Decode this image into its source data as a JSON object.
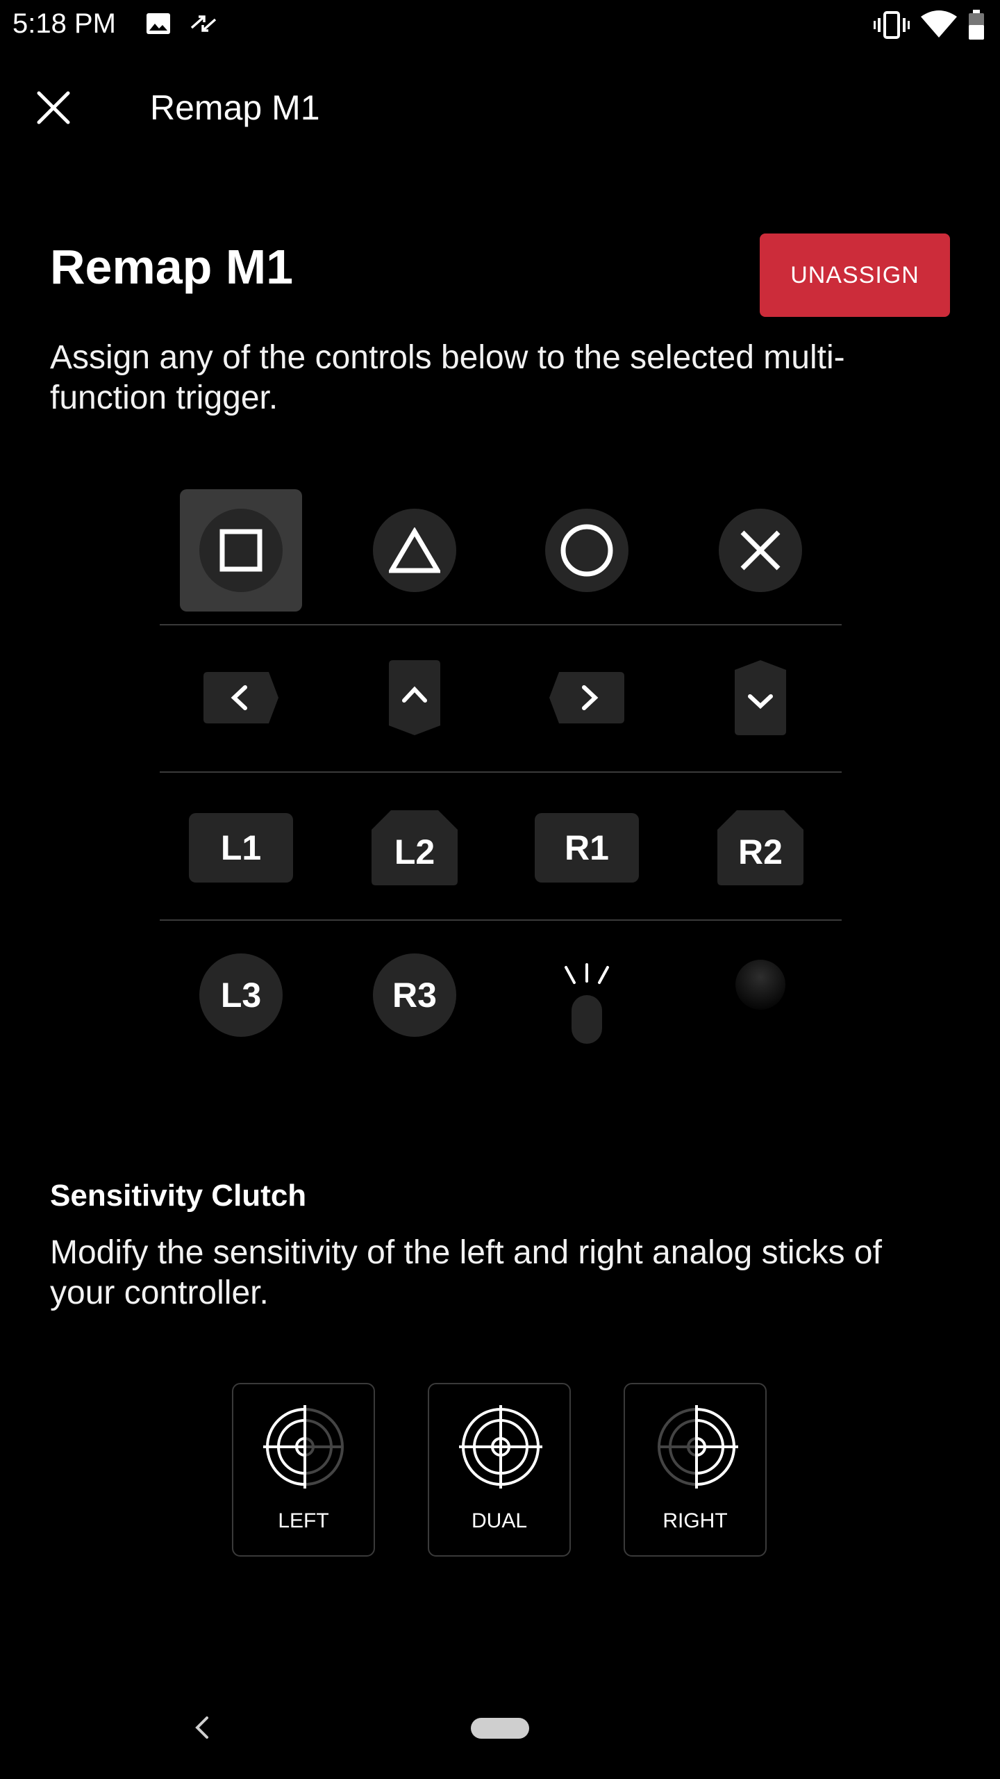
{
  "status_bar": {
    "time": "5:18 PM",
    "left_icons": [
      "image-icon",
      "sync-arrows-icon"
    ],
    "right_icons": [
      "vibrate-icon",
      "wifi-icon",
      "battery-icon"
    ]
  },
  "app_bar": {
    "title": "Remap M1"
  },
  "header": {
    "title": "Remap M1",
    "unassign_label": "UNASSIGN",
    "description": "Assign any of the controls below to the selected multi-function trigger."
  },
  "controls": {
    "face_buttons": [
      "square",
      "triangle",
      "circle",
      "cross"
    ],
    "selected": "square",
    "dpad": [
      "left",
      "up",
      "right",
      "down"
    ],
    "shoulders": [
      "L1",
      "L2",
      "R1",
      "R2"
    ],
    "sticks_row": [
      "L3",
      "R3",
      "touchpad-icon",
      "ball-icon"
    ]
  },
  "sensitivity": {
    "title": "Sensitivity Clutch",
    "description": "Modify the sensitivity of the left and right analog sticks of your controller.",
    "options": [
      {
        "label": "LEFT",
        "icon": "crosshair-left-icon"
      },
      {
        "label": "DUAL",
        "icon": "crosshair-dual-icon"
      },
      {
        "label": "RIGHT",
        "icon": "crosshair-right-icon"
      }
    ]
  },
  "colors": {
    "accent": "#cc2c3a",
    "button_bg": "#262626",
    "selected_bg": "#3a3a3a"
  }
}
